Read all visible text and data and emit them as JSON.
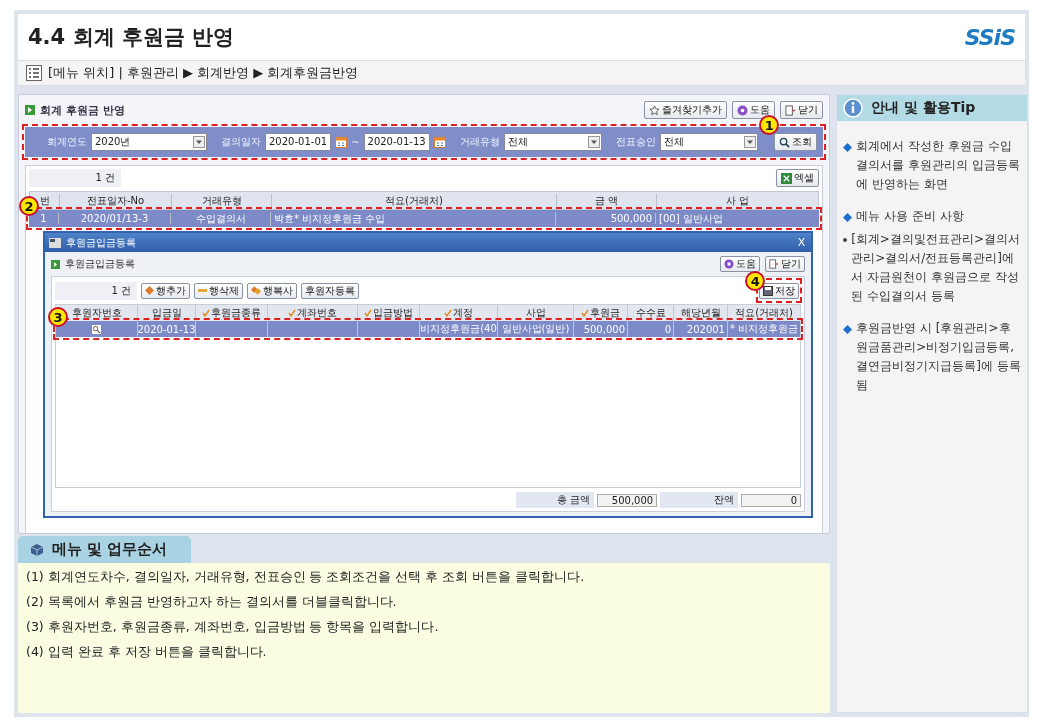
{
  "page": {
    "title": "4.4 회계 후원금 반영",
    "logo": "SSiS"
  },
  "breadcrumb": "[메뉴 위치] | 후원관리 ▶ 회계반영 ▶ 회계후원금반영",
  "screen": {
    "title": "회계 후원금 반영",
    "buttons": [
      {
        "kind": "favorite",
        "label": "즐겨찾기추가"
      },
      {
        "kind": "help",
        "label": "도움"
      },
      {
        "kind": "close",
        "label": "닫기"
      }
    ],
    "filter": {
      "callout": "1",
      "search_button": "조회",
      "fields": [
        {
          "kind": "select",
          "label": "회계연도",
          "value": "2020년"
        },
        {
          "kind": "daterange",
          "label": "결의일자",
          "from": "2020-01-01",
          "separator": "~",
          "to": "2020-01-13"
        },
        {
          "kind": "select",
          "label": "거래유형",
          "value": "전체"
        },
        {
          "kind": "select",
          "label": "전표승인",
          "value": "전체"
        }
      ]
    },
    "count": "1 건",
    "excel_button": "엑셀",
    "table": {
      "callout": "2",
      "columns": [
        "번",
        "전표일자-No",
        "거래유형",
        "적요(거래처)",
        "금 액",
        "사 업"
      ],
      "rows": [
        {
          "selected": true,
          "cells": [
            "1",
            "2020/01/13-3",
            "수입결의서",
            "박효* 비지정후원금 수입",
            "500,000",
            "[00] 일반사업"
          ]
        }
      ]
    },
    "dialog": {
      "window_title": "후원금입금등록",
      "close": "X",
      "title": "후원금입금등록",
      "buttons": [
        {
          "kind": "help",
          "label": "도움"
        },
        {
          "kind": "close",
          "label": "닫기"
        }
      ],
      "count": "1 건",
      "row_buttons": [
        {
          "kind": "add",
          "label": "행추가"
        },
        {
          "kind": "delete",
          "label": "행삭제"
        },
        {
          "kind": "copy",
          "label": "행복사"
        },
        {
          "kind": "plain",
          "label": "후원자등록"
        }
      ],
      "save_button": "저장",
      "save_callout": "4",
      "table": {
        "callout": "3",
        "columns": [
          {
            "label": "후원자번호",
            "required": false
          },
          {
            "label": "입금일",
            "required": false
          },
          {
            "label": "후원금종류",
            "required": true
          },
          {
            "label": "계좌번호",
            "required": true
          },
          {
            "label": "입금방법",
            "required": true
          },
          {
            "label": "계정",
            "required": true
          },
          {
            "label": "사업",
            "required": false
          },
          {
            "label": "후원금",
            "required": true
          },
          {
            "label": "수수료",
            "required": false
          },
          {
            "label": "해당년월",
            "required": false
          },
          {
            "label": "적요(거래처)",
            "required": false
          }
        ],
        "rows": [
          {
            "selected": true,
            "cells": [
              {
                "kind": "lookup"
              },
              {
                "kind": "text",
                "text": "2020-01-13"
              },
              {
                "kind": "text"
              },
              {
                "kind": "text"
              },
              {
                "kind": "text"
              },
              {
                "kind": "text",
                "text": "비지정후원금(40"
              },
              {
                "kind": "text",
                "text": "일반사업(일반)"
              },
              {
                "kind": "number",
                "text": "500,000"
              },
              {
                "kind": "number",
                "text": "0"
              },
              {
                "kind": "number",
                "text": "202001"
              },
              {
                "kind": "text",
                "text": "* 비지정후원금"
              }
            ]
          }
        ]
      },
      "totals": [
        {
          "label": "총 금액",
          "value": "500,000"
        },
        {
          "label": "잔액",
          "value": "0"
        }
      ]
    }
  },
  "tips": {
    "title": "안내 및 활용Tip",
    "items": [
      {
        "kind": "main",
        "text": "회계에서 작성한 후원금 수입결의서를 후원관리의 입금등록에 반영하는 화면"
      },
      {
        "kind": "main",
        "text": "메뉴 사용 준비 사항"
      },
      {
        "kind": "sub",
        "text": "[회계>결의및전표관리>결의서관리>결의서/전표등록관리]에서 자금원천이 후원금으로 작성된 수입결의서 등록"
      },
      {
        "kind": "main",
        "text": "후원금반영 시 [후원관리>후원금품관리>비정기입금등록, 결연금비정기지급등록]에 등록 됨"
      }
    ]
  },
  "guide": {
    "title": "메뉴 및 업무순서",
    "steps": [
      "(1) 회계연도차수, 결의일자, 거래유형, 전표승인 등 조회조건을 선택 후 조회 버튼을 클릭합니다.",
      "(2) 목록에서 후원금 반영하고자 하는 결의서를 더블클릭합니다.",
      "(3) 후원자번호, 후원금종류, 계좌번호, 입금방법 등 항목을 입력합니다.",
      "(4) 입력 완료 후 저장 버튼을 클릭합니다."
    ]
  }
}
